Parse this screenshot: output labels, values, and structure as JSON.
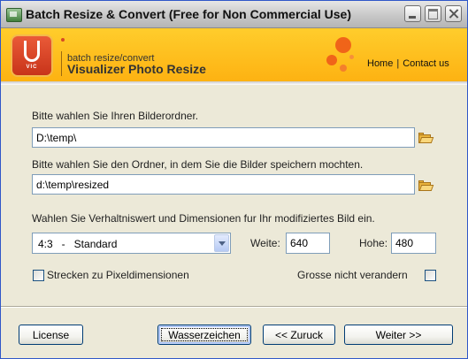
{
  "window": {
    "title": "Batch Resize & Convert (Free for Non Commercial Use)",
    "controls": [
      "minimize-icon",
      "maximize-icon",
      "close-icon"
    ]
  },
  "header": {
    "logo_text": "VIC",
    "subtitle": "batch resize/convert",
    "product_name": "Visualizer Photo Resize",
    "nav": {
      "home": "Home",
      "separator": "|",
      "contact": "Contact us"
    },
    "accent_color": "#fdb212",
    "dot_color": "#f06419"
  },
  "form": {
    "source_label": "Bitte wahlen Sie Ihren Bilderordner.",
    "source_value": "D:\\temp\\",
    "dest_label": "Bitte wahlen Sie den Ordner, in dem Sie die Bilder speichern mochten.",
    "dest_value": "d:\\temp\\resized",
    "ratio_label": "Wahlen Sie Verhaltniswert und Dimensionen fur Ihr modifiziertes Bild ein.",
    "ratio_selected": "4:3   -   Standard",
    "width_label": "Weite:",
    "width_value": "640",
    "height_label": "Hohe:",
    "height_value": "480",
    "stretch_label": "Strecken zu Pixeldimensionen",
    "stretch_checked": false,
    "keep_size_label": "Grosse nicht verandern",
    "keep_size_checked": false
  },
  "buttons": {
    "license": "License",
    "watermark": "Wasserzeichen",
    "back": "<< Zuruck",
    "next": "Weiter >>"
  }
}
